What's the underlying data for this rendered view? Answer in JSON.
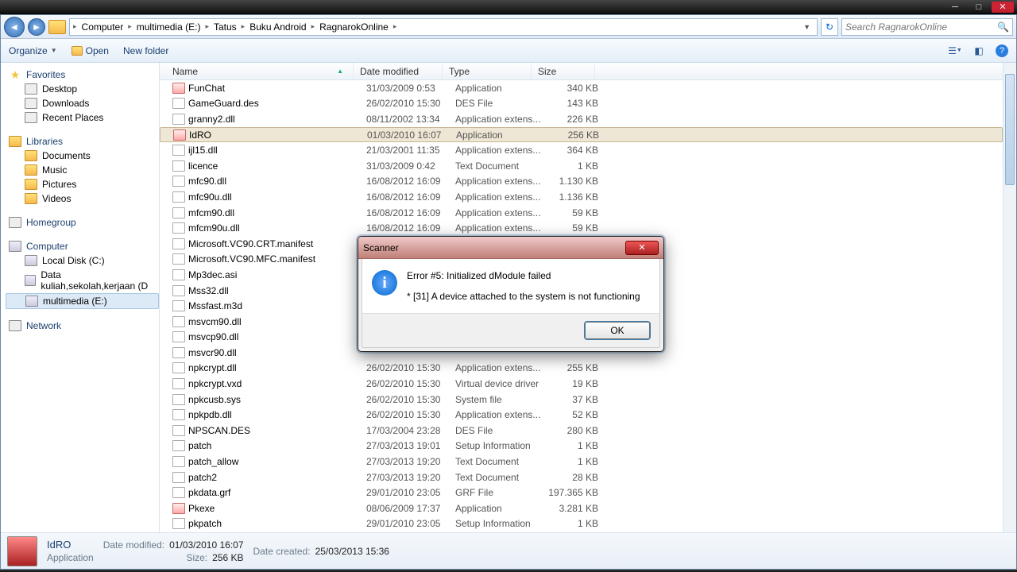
{
  "breadcrumb": [
    "Computer",
    "multimedia (E:)",
    "Tatus",
    "Buku Android",
    "RagnarokOnline"
  ],
  "search_placeholder": "Search RagnarokOnline",
  "toolbar": {
    "organize": "Organize",
    "open": "Open",
    "newfolder": "New folder"
  },
  "sidebar": {
    "favorites": {
      "title": "Favorites",
      "items": [
        "Desktop",
        "Downloads",
        "Recent Places"
      ]
    },
    "libraries": {
      "title": "Libraries",
      "items": [
        "Documents",
        "Music",
        "Pictures",
        "Videos"
      ]
    },
    "homegroup": {
      "title": "Homegroup"
    },
    "computer": {
      "title": "Computer",
      "items": [
        "Local Disk (C:)",
        "Data kuliah,sekolah,kerjaan (D",
        "multimedia (E:)"
      ]
    },
    "network": {
      "title": "Network"
    }
  },
  "columns": {
    "name": "Name",
    "date": "Date modified",
    "type": "Type",
    "size": "Size"
  },
  "files": [
    {
      "n": "FunChat",
      "d": "31/03/2009 0:53",
      "t": "Application",
      "s": "340 KB",
      "app": true
    },
    {
      "n": "GameGuard.des",
      "d": "26/02/2010 15:30",
      "t": "DES File",
      "s": "143 KB"
    },
    {
      "n": "granny2.dll",
      "d": "08/11/2002 13:34",
      "t": "Application extens...",
      "s": "226 KB"
    },
    {
      "n": "IdRO",
      "d": "01/03/2010 16:07",
      "t": "Application",
      "s": "256 KB",
      "app": true,
      "sel": true
    },
    {
      "n": "ijl15.dll",
      "d": "21/03/2001 11:35",
      "t": "Application extens...",
      "s": "364 KB"
    },
    {
      "n": "licence",
      "d": "31/03/2009 0:42",
      "t": "Text Document",
      "s": "1 KB"
    },
    {
      "n": "mfc90.dll",
      "d": "16/08/2012 16:09",
      "t": "Application extens...",
      "s": "1.130 KB"
    },
    {
      "n": "mfc90u.dll",
      "d": "16/08/2012 16:09",
      "t": "Application extens...",
      "s": "1.136 KB"
    },
    {
      "n": "mfcm90.dll",
      "d": "16/08/2012 16:09",
      "t": "Application extens...",
      "s": "59 KB"
    },
    {
      "n": "mfcm90u.dll",
      "d": "16/08/2012 16:09",
      "t": "Application extens...",
      "s": "59 KB"
    },
    {
      "n": "Microsoft.VC90.CRT.manifest",
      "d": "",
      "t": "",
      "s": ""
    },
    {
      "n": "Microsoft.VC90.MFC.manifest",
      "d": "",
      "t": "",
      "s": ""
    },
    {
      "n": "Mp3dec.asi",
      "d": "",
      "t": "",
      "s": ""
    },
    {
      "n": "Mss32.dll",
      "d": "",
      "t": "",
      "s": ""
    },
    {
      "n": "Mssfast.m3d",
      "d": "",
      "t": "",
      "s": ""
    },
    {
      "n": "msvcm90.dll",
      "d": "",
      "t": "",
      "s": ""
    },
    {
      "n": "msvcp90.dll",
      "d": "",
      "t": "",
      "s": ""
    },
    {
      "n": "msvcr90.dll",
      "d": "",
      "t": "",
      "s": ""
    },
    {
      "n": "npkcrypt.dll",
      "d": "26/02/2010 15:30",
      "t": "Application extens...",
      "s": "255 KB"
    },
    {
      "n": "npkcrypt.vxd",
      "d": "26/02/2010 15:30",
      "t": "Virtual device driver",
      "s": "19 KB"
    },
    {
      "n": "npkcusb.sys",
      "d": "26/02/2010 15:30",
      "t": "System file",
      "s": "37 KB"
    },
    {
      "n": "npkpdb.dll",
      "d": "26/02/2010 15:30",
      "t": "Application extens...",
      "s": "52 KB"
    },
    {
      "n": "NPSCAN.DES",
      "d": "17/03/2004 23:28",
      "t": "DES File",
      "s": "280 KB"
    },
    {
      "n": "patch",
      "d": "27/03/2013 19:01",
      "t": "Setup Information",
      "s": "1 KB"
    },
    {
      "n": "patch_allow",
      "d": "27/03/2013 19:20",
      "t": "Text Document",
      "s": "1 KB"
    },
    {
      "n": "patch2",
      "d": "27/03/2013 19:20",
      "t": "Text Document",
      "s": "28 KB"
    },
    {
      "n": "pkdata.grf",
      "d": "29/01/2010 23:05",
      "t": "GRF File",
      "s": "197.365 KB"
    },
    {
      "n": "Pkexe",
      "d": "08/06/2009 17:37",
      "t": "Application",
      "s": "3.281 KB",
      "app": true
    },
    {
      "n": "pkpatch",
      "d": "29/01/2010 23:05",
      "t": "Setup Information",
      "s": "1 KB"
    }
  ],
  "details": {
    "name": "IdRO",
    "type": "Application",
    "datemod_lbl": "Date modified:",
    "datemod": "01/03/2010 16:07",
    "size_lbl": "Size:",
    "size": "256 KB",
    "created_lbl": "Date created:",
    "created": "25/03/2013 15:36"
  },
  "dialog": {
    "title": "Scanner",
    "line1": "Error #5: Initialized dModule failed",
    "line2": "* [31] A device attached to the system is not functioning",
    "ok": "OK"
  }
}
